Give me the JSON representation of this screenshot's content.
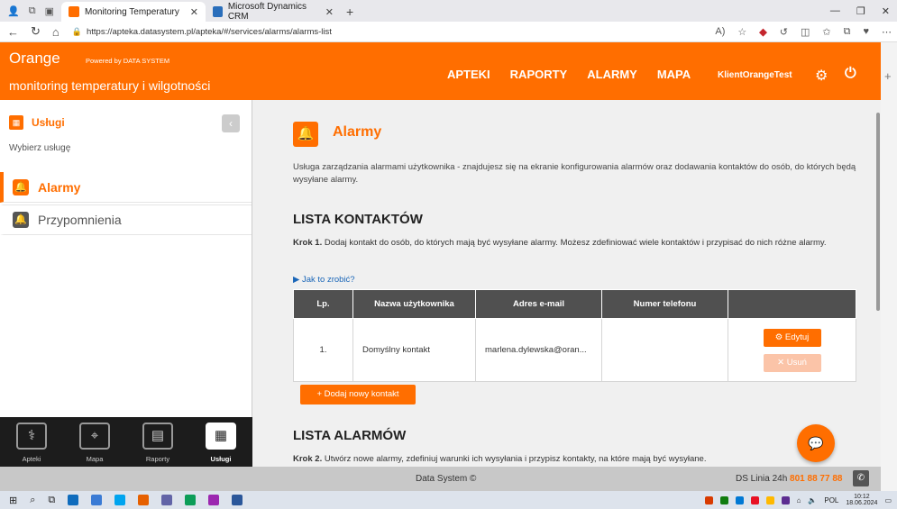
{
  "browser": {
    "tabs": [
      {
        "title": "Monitoring Temperatury",
        "active": true
      },
      {
        "title": "Microsoft Dynamics CRM",
        "active": false
      }
    ],
    "url": "https://apteka.datasystem.pl/apteka/#/services/alarms/alarms-list"
  },
  "header": {
    "brand": "Orange",
    "powered_by": "Powered by DATA SYSTEM",
    "subtitle": "monitoring temperatury i wilgotności",
    "nav": [
      "APTEKI",
      "RAPORTY",
      "ALARMY",
      "MAPA"
    ],
    "user": "KlientOrangeTest"
  },
  "sidebar": {
    "title": "Usługi",
    "subtitle": "Wybierz usługę",
    "items": [
      {
        "label": "Alarmy",
        "active": true
      },
      {
        "label": "Przypomnienia",
        "active": false
      }
    ]
  },
  "bottom_nav": [
    {
      "label": "Apteki",
      "active": false
    },
    {
      "label": "Mapa",
      "active": false
    },
    {
      "label": "Raporty",
      "active": false
    },
    {
      "label": "Usługi",
      "active": true
    }
  ],
  "page": {
    "title": "Alarmy",
    "description": "Usługa zarządzania alarmami użytkownika - znajdujesz się na ekranie konfigurowania alarmów oraz dodawania kontaktów do osób, do których będą wysyłane alarmy.",
    "contacts_section": {
      "title": "LISTA KONTAKTÓW",
      "step_label": "Krok 1.",
      "step_text": "Dodaj kontakt do osób, do których mają być wysyłane alarmy. Możesz zdefiniować wiele kontaktów i przypisać do nich różne alarmy.",
      "howto": "Jak to zrobić?",
      "columns": [
        "Lp.",
        "Nazwa użytkownika",
        "Adres e-mail",
        "Numer telefonu",
        ""
      ],
      "rows": [
        {
          "lp": "1.",
          "name": "Domyślny kontakt",
          "email": "marlena.dylewska@oran...",
          "phone": ""
        }
      ],
      "edit_label": "Edytuj",
      "delete_label": "Usuń",
      "add_label": "Dodaj nowy kontakt"
    },
    "alarms_section": {
      "title": "LISTA ALARMÓW",
      "step_label": "Krok 2.",
      "step_text": "Utwórz nowe alarmy, zdefiniuj warunki ich wysyłania i przypisz kontakty, na które mają być wysyłane."
    }
  },
  "footer": {
    "center": "Data System ©",
    "right_label": "DS Linia 24h",
    "right_phone": "801 88 77 88"
  },
  "taskbar": {
    "lang": "POL",
    "time": "10:12",
    "date": "18.06.2024"
  },
  "colors": {
    "accent": "#ff6e00",
    "dark": "#505050",
    "footer": "#c8c8c8"
  }
}
